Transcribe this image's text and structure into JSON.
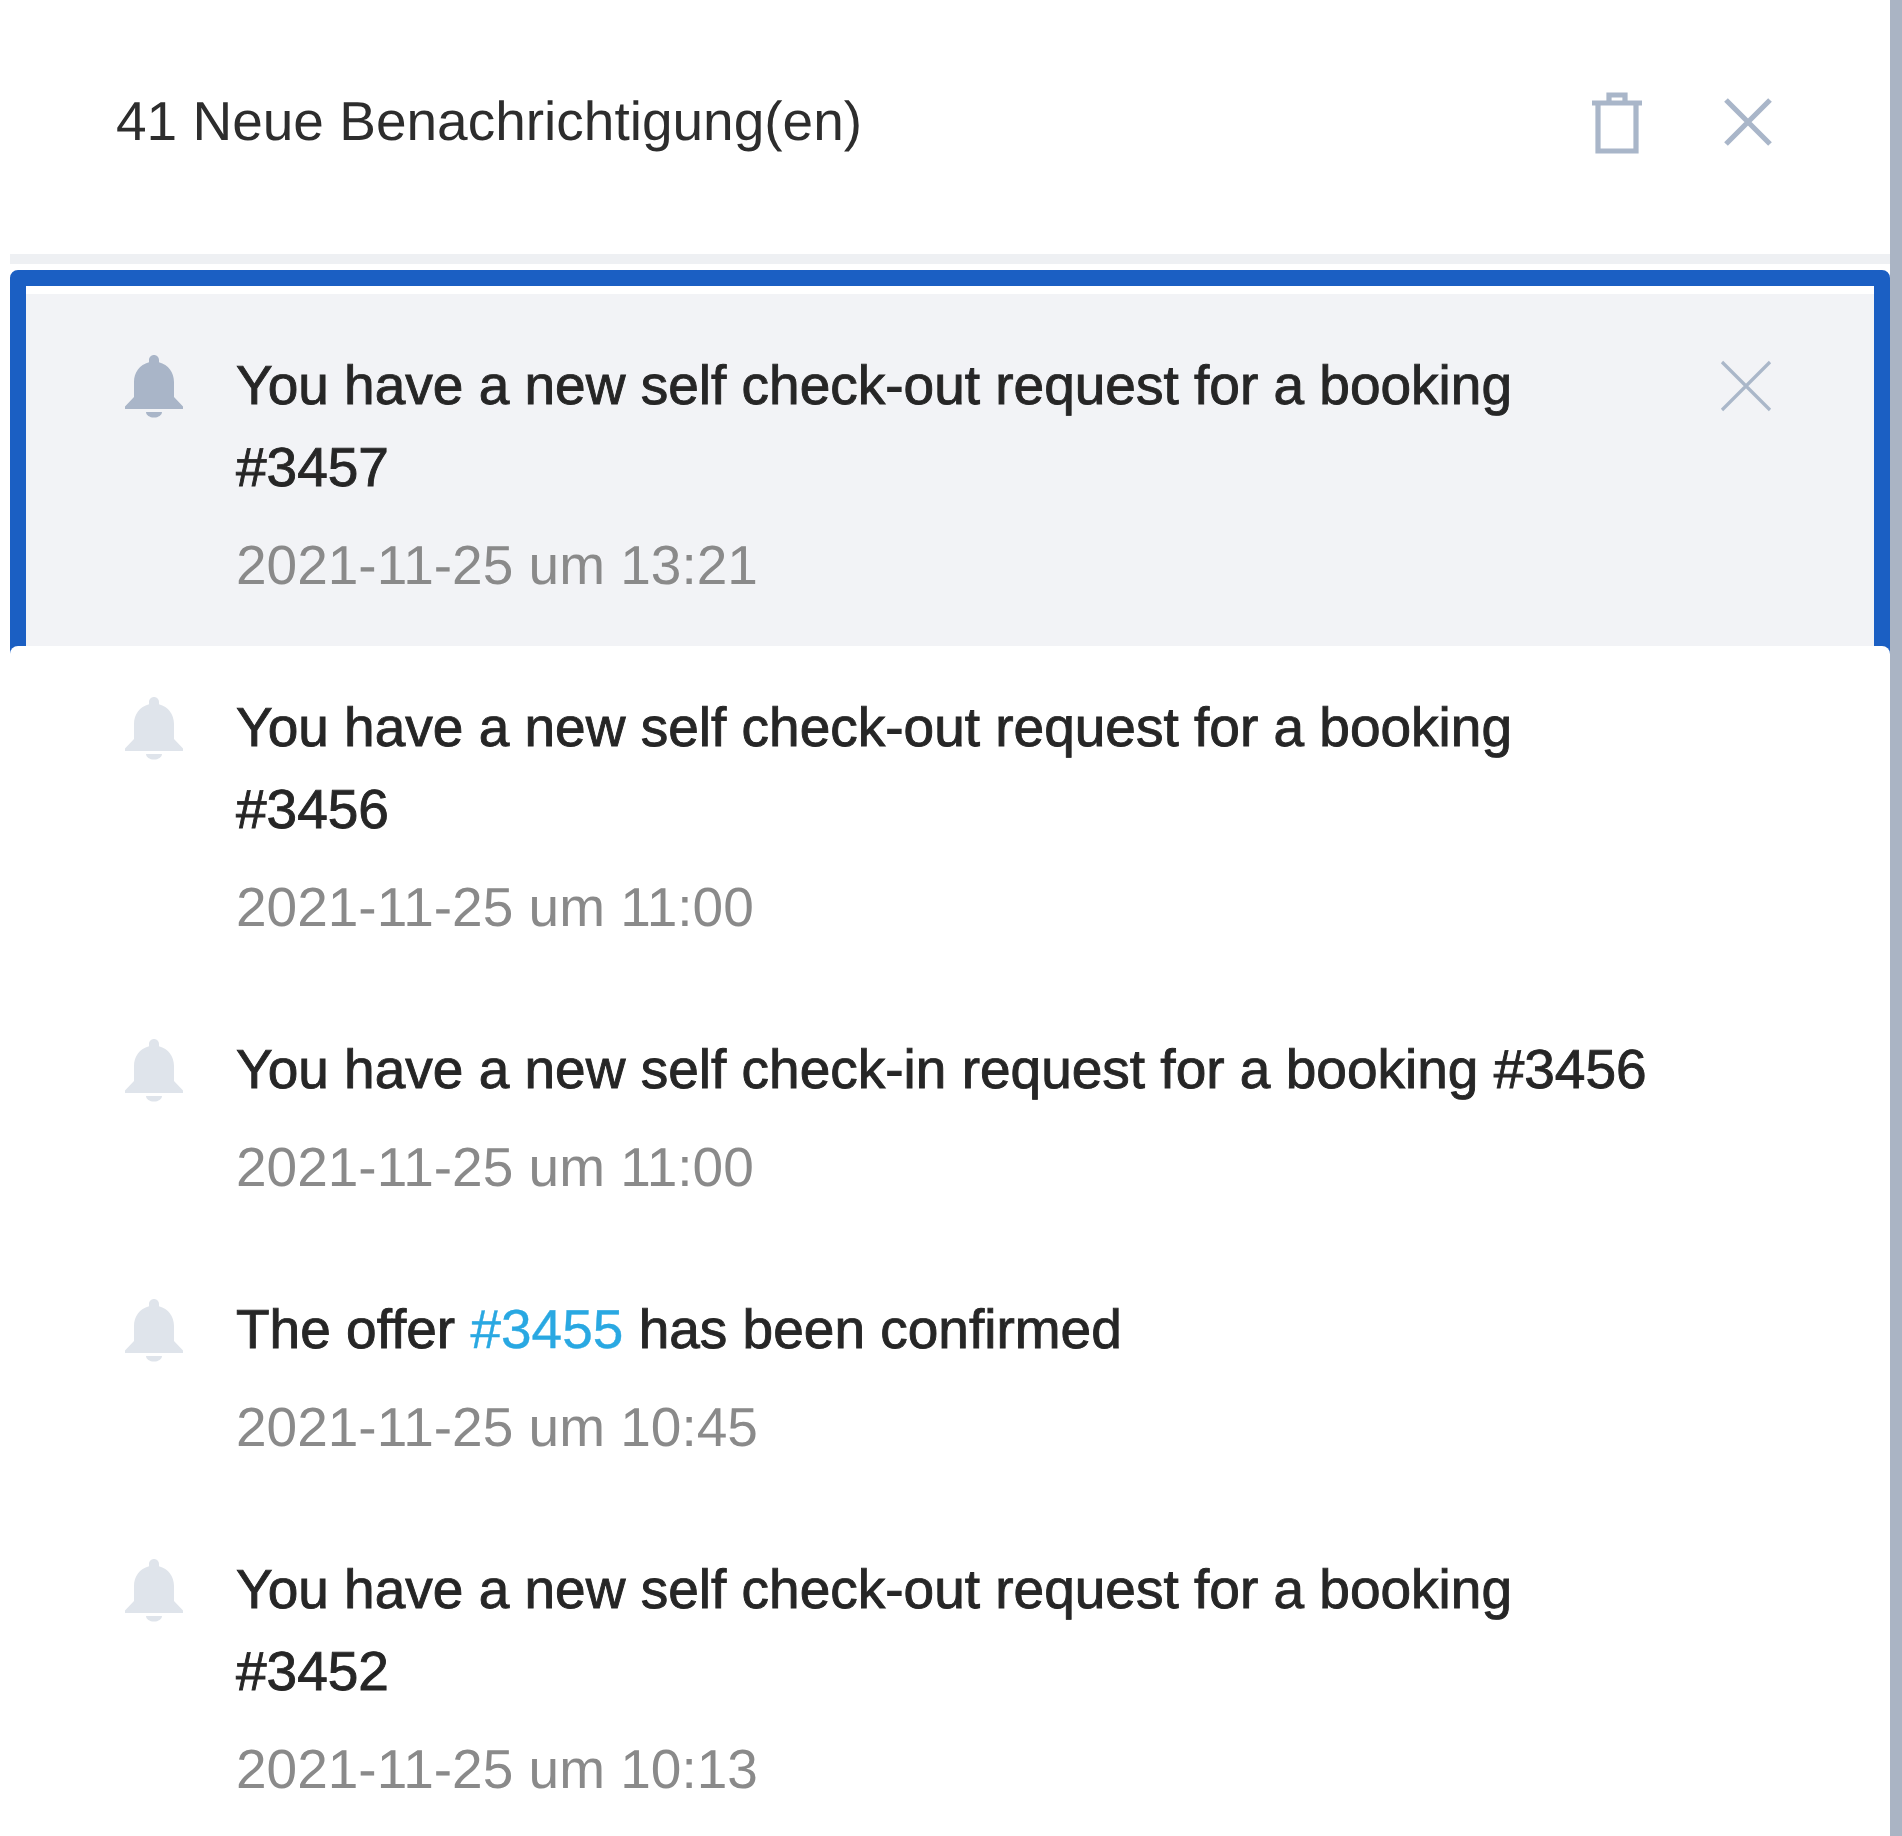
{
  "header": {
    "title": "41 Neue Benachrichtigung(en)"
  },
  "notifications": [
    {
      "message": [
        {
          "kind": "text",
          "text": "You have a new self check-out request for a booking #3457"
        }
      ],
      "time": "2021-11-25 um 13:21",
      "selected": true
    },
    {
      "message": [
        {
          "kind": "text",
          "text": "You have a new self check-out request for a booking #3456"
        }
      ],
      "time": "2021-11-25 um 11:00",
      "selected": false
    },
    {
      "message": [
        {
          "kind": "text",
          "text": "You have a new self check-in request for a booking #3456"
        }
      ],
      "time": "2021-11-25 um 11:00",
      "selected": false
    },
    {
      "message": [
        {
          "kind": "text",
          "text": "The offer "
        },
        {
          "kind": "link",
          "text": "#3455"
        },
        {
          "kind": "text",
          "text": " has been confirmed"
        }
      ],
      "time": "2021-11-25 um 10:45",
      "selected": false
    },
    {
      "message": [
        {
          "kind": "text",
          "text": "You have a new self check-out request for a booking #3452"
        }
      ],
      "time": "2021-11-25 um 10:13",
      "selected": false
    }
  ]
}
